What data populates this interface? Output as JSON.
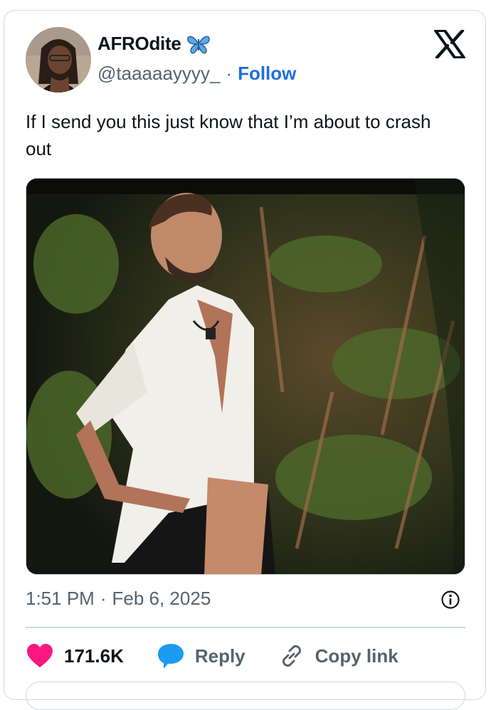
{
  "author": {
    "display_name": "AFROdite",
    "handle": "@taaaaayyyy_",
    "separator": "·",
    "follow_label": "Follow"
  },
  "tweet": {
    "text": "If I send you this just know that I’m about to crash out",
    "time": "1:51 PM",
    "date_separator": "·",
    "date": "Feb 6, 2025"
  },
  "actions": {
    "like_count": "171.6K",
    "reply_label": "Reply",
    "copy_link_label": "Copy link"
  },
  "colors": {
    "accent": "#1d6ee0",
    "like": "#f91880",
    "reply_icon": "#1d9bf0",
    "muted": "#536471",
    "border": "#cfd9de"
  },
  "icons": [
    "butterfly-icon",
    "x-logo-icon",
    "info-icon",
    "heart-icon",
    "reply-bubble-icon",
    "link-icon"
  ]
}
